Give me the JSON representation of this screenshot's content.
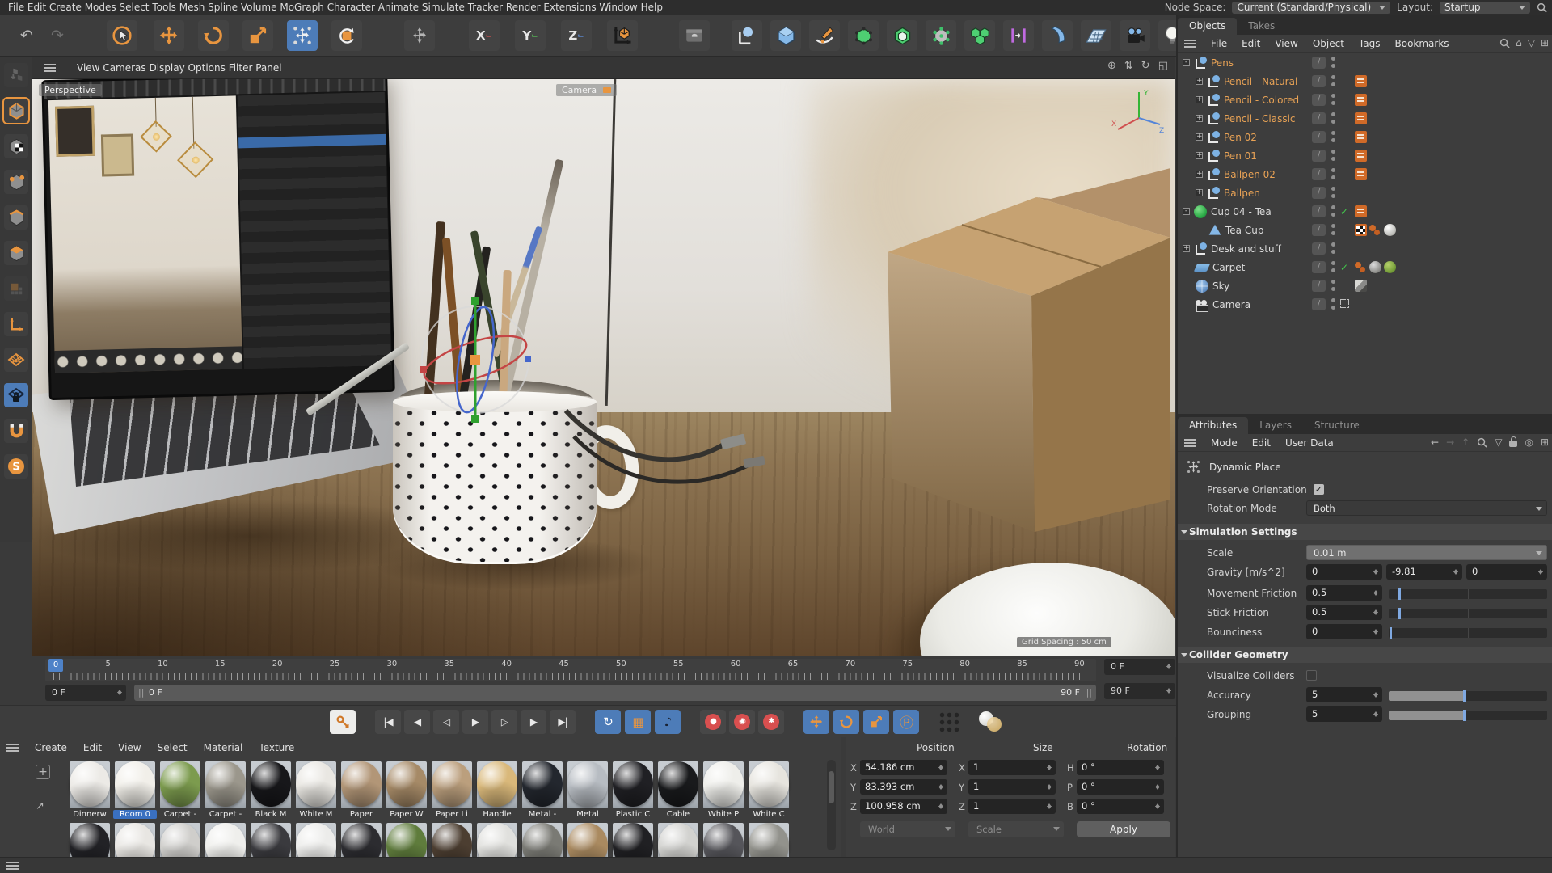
{
  "menubar": {
    "items": [
      "File",
      "Edit",
      "Create",
      "Modes",
      "Select",
      "Tools",
      "Mesh",
      "Spline",
      "Volume",
      "MoGraph",
      "Character",
      "Animate",
      "Simulate",
      "Tracker",
      "Render",
      "Extensions",
      "Window",
      "Help"
    ],
    "node_space_label": "Node Space:",
    "node_space_value": "Current (Standard/Physical)",
    "layout_label": "Layout:",
    "layout_value": "Startup"
  },
  "toolbar": {
    "axis_locks": [
      "X",
      "Y",
      "Z"
    ]
  },
  "viewport": {
    "menu": [
      "View",
      "Cameras",
      "Display",
      "Options",
      "Filter",
      "Panel"
    ],
    "corner_icons": [
      {
        "n": "pan-view-icon",
        "g": "⊕"
      },
      {
        "n": "zoom-view-icon",
        "g": "⇅"
      },
      {
        "n": "rotate-view-icon",
        "g": "↻"
      },
      {
        "n": "toggle-view-icon",
        "g": "◱"
      }
    ],
    "perspective_label": "Perspective",
    "camera_label": "Camera",
    "grid_spacing_label": "Grid Spacing : 50 cm",
    "axis_x": "X",
    "axis_y": "Y",
    "axis_z": "Z"
  },
  "objects_panel": {
    "tabs": [
      {
        "label": "Objects",
        "cls": "on"
      },
      {
        "label": "Takes",
        "cls": ""
      }
    ],
    "menu": [
      "File",
      "Edit",
      "View",
      "Object",
      "Tags",
      "Bookmarks"
    ],
    "tree": [
      {
        "name": "Pens",
        "c": "o",
        "icon": "ic-null",
        "dep": "d0",
        "exp": "-",
        "tags": []
      },
      {
        "name": "Pencil - Natural",
        "c": "o",
        "icon": "ic-null",
        "dep": "d1",
        "exp": "+",
        "tags": [
          "note"
        ]
      },
      {
        "name": "Pencil - Colored",
        "c": "o",
        "icon": "ic-null",
        "dep": "d1",
        "exp": "+",
        "tags": [
          "note"
        ]
      },
      {
        "name": "Pencil - Classic",
        "c": "o",
        "icon": "ic-null",
        "dep": "d1",
        "exp": "+",
        "tags": [
          "note"
        ]
      },
      {
        "name": "Pen 02",
        "c": "o",
        "icon": "ic-null",
        "dep": "d1",
        "exp": "+",
        "tags": [
          "note"
        ]
      },
      {
        "name": "Pen 01",
        "c": "o",
        "icon": "ic-null",
        "dep": "d1",
        "exp": "+",
        "tags": [
          "note"
        ]
      },
      {
        "name": "Ballpen 02",
        "c": "o",
        "icon": "ic-null",
        "dep": "d1",
        "exp": "+",
        "tags": [
          "note"
        ]
      },
      {
        "name": "Ballpen",
        "c": "o",
        "icon": "ic-null",
        "dep": "d1",
        "exp": "+",
        "tags": []
      },
      {
        "name": "Cup 04 - Tea",
        "c": "w",
        "icon": "ic-green-ball",
        "dep": "d0",
        "exp": "-",
        "check": true,
        "tags": [
          "note"
        ]
      },
      {
        "name": "Tea Cup",
        "c": "w",
        "icon": "ic-poly",
        "dep": "d1",
        "exp": "",
        "tags": [
          "checker",
          "dots",
          "sphere-white"
        ]
      },
      {
        "name": "Desk and stuff",
        "c": "w",
        "icon": "ic-null",
        "dep": "d0",
        "exp": "+",
        "tags": []
      },
      {
        "name": "Carpet",
        "c": "w",
        "icon": "ic-plane",
        "dep": "d0",
        "exp": "",
        "check": true,
        "tags": [
          "dots",
          "sphere-gray",
          "sphere-green"
        ]
      },
      {
        "name": "Sky",
        "c": "w",
        "icon": "ic-sky",
        "dep": "d0",
        "exp": "",
        "tags": [
          "photo"
        ]
      },
      {
        "name": "Camera",
        "c": "w",
        "icon": "ic-camera",
        "dep": "d0",
        "exp": "",
        "cross": true,
        "tags": []
      }
    ]
  },
  "attributes_panel": {
    "tabs": [
      {
        "label": "Attributes",
        "cls": "on"
      },
      {
        "label": "Layers",
        "cls": ""
      },
      {
        "label": "Structure",
        "cls": ""
      }
    ],
    "menu": [
      "Mode",
      "Edit",
      "User Data"
    ],
    "title": "Dynamic Place",
    "preserve_orientation_label": "Preserve Orientation",
    "rotation_mode_label": "Rotation Mode",
    "rotation_mode_value": "Both",
    "sim_header": "Simulation Settings",
    "scale_label": "Scale",
    "scale_value": "0.01 m",
    "gravity_label": "Gravity [m/s^2]",
    "gravity_x": "0",
    "gravity_y": "-9.81",
    "gravity_z": "0",
    "movement_friction_label": "Movement Friction",
    "movement_friction_value": "0.5",
    "stick_friction_label": "Stick Friction",
    "stick_friction_value": "0.5",
    "bounciness_label": "Bounciness",
    "bounciness_value": "0",
    "collider_header": "Collider Geometry",
    "visualize_label": "Visualize Colliders",
    "accuracy_label": "Accuracy",
    "accuracy_value": "5",
    "grouping_label": "Grouping",
    "grouping_value": "5"
  },
  "timeline": {
    "ticks": [
      "0",
      "5",
      "10",
      "15",
      "20",
      "25",
      "30",
      "35",
      "40",
      "45",
      "50",
      "55",
      "60",
      "65",
      "70",
      "75",
      "80",
      "85",
      "90"
    ],
    "playhead_frame": "0",
    "current_frame": "0 F",
    "range_start": "0 F",
    "range_end": "90 F",
    "loop_min": "0 F",
    "loop_max": "90 F"
  },
  "playback": {
    "transport": [
      {
        "n": "goto-start-button",
        "g": "|◀"
      },
      {
        "n": "prev-key-button",
        "g": "◀"
      },
      {
        "n": "prev-frame-button",
        "g": "◁"
      },
      {
        "n": "play-button",
        "g": "▶"
      },
      {
        "n": "next-frame-button",
        "g": "▷"
      },
      {
        "n": "next-key-button",
        "g": "▶"
      },
      {
        "n": "goto-end-button",
        "g": "▶|"
      }
    ],
    "record_icons": [
      {
        "n": "record-position-button",
        "g": "●"
      },
      {
        "n": "record-rotation-button",
        "g": "◉"
      },
      {
        "n": "record-parameter-button",
        "g": "✱"
      }
    ],
    "loop_glyph": "↻",
    "film_glyph": "▦",
    "sound_glyph": "♪",
    "p_glyph": "Ⓟ"
  },
  "materials_panel": {
    "menu": [
      "Create",
      "Edit",
      "View",
      "Select",
      "Material",
      "Texture"
    ],
    "row1": [
      {
        "name": "Dinnerw",
        "color": "#eceae6"
      },
      {
        "name": "Room 0",
        "color": "#f1efe9",
        "sel": "sel"
      },
      {
        "name": "Carpet -",
        "color": "#7c9b4e"
      },
      {
        "name": "Carpet -",
        "color": "#9b978c"
      },
      {
        "name": "Black M",
        "color": "#17171a"
      },
      {
        "name": "White M",
        "color": "#e9e7e2"
      },
      {
        "name": "Paper",
        "color": "#b29677"
      },
      {
        "name": "Paper W",
        "color": "#a68a67"
      },
      {
        "name": "Paper Li",
        "color": "#bb9f7d"
      },
      {
        "name": "Handle",
        "color": "#d9b87a"
      },
      {
        "name": "Metal -",
        "color": "#23272e"
      },
      {
        "name": "Metal",
        "color": "#b7bcc2"
      },
      {
        "name": "Plastic C",
        "color": "#202024"
      },
      {
        "name": "Cable",
        "color": "#191a1c"
      },
      {
        "name": "White P",
        "color": "#eeeeea"
      },
      {
        "name": "White C",
        "color": "#e6e4de"
      }
    ],
    "row2": [
      {
        "color": "#222226"
      },
      {
        "color": "#e8e6e2"
      },
      {
        "color": "#cfcecb"
      },
      {
        "color": "#efefec"
      },
      {
        "color": "#3a3a3e"
      },
      {
        "color": "#ececea"
      },
      {
        "color": "#2c2c30"
      },
      {
        "color": "#5f7c3c"
      },
      {
        "color": "#4c3e31"
      },
      {
        "color": "#e0e0dd"
      },
      {
        "color": "#7a7a74"
      },
      {
        "color": "#aa8a60"
      },
      {
        "color": "#202023"
      },
      {
        "color": "#d2d2cf"
      },
      {
        "color": "#55555a"
      },
      {
        "color": "#92928c"
      }
    ]
  },
  "coordinates_panel": {
    "position_header": "Position",
    "size_header": "Size",
    "rotation_header": "Rotation",
    "px_label": "X",
    "px": "54.186 cm",
    "py_label": "Y",
    "py": "83.393 cm",
    "pz_label": "Z",
    "pz": "100.958 cm",
    "sx_label": "X",
    "sx": "1",
    "sy_label": "Y",
    "sy": "1",
    "sz_label": "Z",
    "sz": "1",
    "rh_label": "H",
    "rh": "0 °",
    "rp_label": "P",
    "rp": "0 °",
    "rb_label": "B",
    "rb": "0 °",
    "world": "World",
    "scale": "Scale",
    "apply": "Apply"
  }
}
